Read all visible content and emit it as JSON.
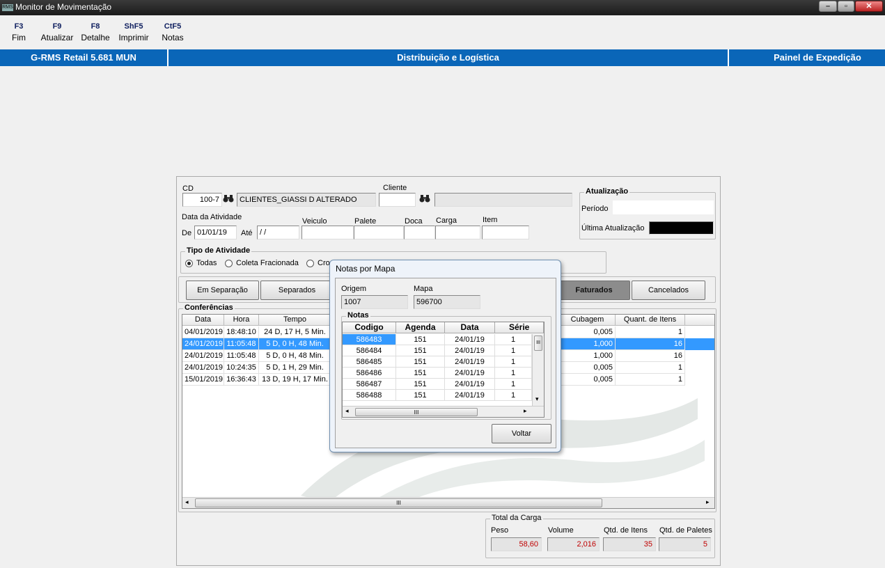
{
  "window": {
    "title": "Monitor de Movimentação",
    "app_icon": "RMS"
  },
  "toolbar": [
    {
      "key": "F3",
      "label": "Fim"
    },
    {
      "key": "F9",
      "label": "Atualizar"
    },
    {
      "key": "F8",
      "label": "Detalhe"
    },
    {
      "key": "ShF5",
      "label": "Imprimir"
    },
    {
      "key": "CtF5",
      "label": "Notas"
    }
  ],
  "header": {
    "app": "G-RMS Retail 5.681 MUN",
    "module": "Distribuição e Logística",
    "screen": "Painel de Expedição"
  },
  "filters": {
    "cd_label": "CD",
    "cd_value": "100-7",
    "cd_name": "CLIENTES_GIASSI D ALTERADO",
    "cliente_label": "Cliente",
    "cliente_value": "",
    "cliente_name": "",
    "data_atividade_label": "Data da Atividade",
    "de_label": "De",
    "de_value": "01/01/19",
    "ate_label": "Até",
    "ate_value": " / /",
    "veiculo_label": "Veiculo",
    "palete_label": "Palete",
    "doca_label": "Doca",
    "carga_label": "Carga",
    "item_label": "Item"
  },
  "atualizacao": {
    "title": "Atualização",
    "periodo_label": "Período",
    "periodo_value": "",
    "ultima_label": "Última Atualização",
    "ultima_value": ""
  },
  "tipo_atividade": {
    "title": "Tipo de Atividade",
    "options": [
      "Todas",
      "Coleta Fracionada",
      "Cros"
    ],
    "selected": "Todas"
  },
  "status_buttons": {
    "em_separacao": "Em Separação",
    "separados": "Separados",
    "faturados": "Faturados",
    "cancelados": "Cancelados"
  },
  "conferencias": {
    "title": "Conferências",
    "headers_left": [
      "Data",
      "Hora",
      "Tempo"
    ],
    "headers_right": [
      "Cubagem",
      "Quant. de Itens"
    ],
    "rows": [
      {
        "data": "04/01/2019",
        "hora": "18:48:10",
        "tempo": "24 D, 17 H, 5 Min.",
        "cubagem": "0,005",
        "itens": "1"
      },
      {
        "data": "24/01/2019",
        "hora": "11:05:48",
        "tempo": "5 D, 0 H, 48 Min.",
        "cubagem": "1,000",
        "itens": "16"
      },
      {
        "data": "24/01/2019",
        "hora": "11:05:48",
        "tempo": "5 D, 0 H, 48 Min.",
        "cubagem": "1,000",
        "itens": "16"
      },
      {
        "data": "24/01/2019",
        "hora": "10:24:35",
        "tempo": "5 D, 1 H, 29 Min.",
        "cubagem": "0,005",
        "itens": "1"
      },
      {
        "data": "15/01/2019",
        "hora": "16:36:43",
        "tempo": "13 D, 19 H, 17 Min.",
        "cubagem": "0,005",
        "itens": "1"
      }
    ],
    "selected_row": 1
  },
  "total_carga": {
    "title": "Total da Carga",
    "peso_label": "Peso",
    "peso": "58,60",
    "volume_label": "Volume",
    "volume": "2,016",
    "itens_label": "Qtd. de Itens",
    "itens": "35",
    "paletes_label": "Qtd. de Paletes",
    "paletes": "5"
  },
  "modal": {
    "title": "Notas por Mapa",
    "origem_label": "Origem",
    "origem": "1007",
    "mapa_label": "Mapa",
    "mapa": "596700",
    "notas_title": "Notas",
    "headers": [
      "Codigo",
      "Agenda",
      "Data",
      "Série"
    ],
    "rows": [
      {
        "codigo": "586483",
        "agenda": "151",
        "data": "24/01/19",
        "serie": "1"
      },
      {
        "codigo": "586484",
        "agenda": "151",
        "data": "24/01/19",
        "serie": "1"
      },
      {
        "codigo": "586485",
        "agenda": "151",
        "data": "24/01/19",
        "serie": "1"
      },
      {
        "codigo": "586486",
        "agenda": "151",
        "data": "24/01/19",
        "serie": "1"
      },
      {
        "codigo": "586487",
        "agenda": "151",
        "data": "24/01/19",
        "serie": "1"
      },
      {
        "codigo": "586488",
        "agenda": "151",
        "data": "24/01/19",
        "serie": "1"
      }
    ],
    "selected_row": 0,
    "scroll_grip": "III",
    "voltar": "Voltar"
  },
  "scroll_grip": "III",
  "colors": {
    "header_blue": "#0a66b8",
    "selection": "#3399ff",
    "total_red": "#c00000"
  }
}
